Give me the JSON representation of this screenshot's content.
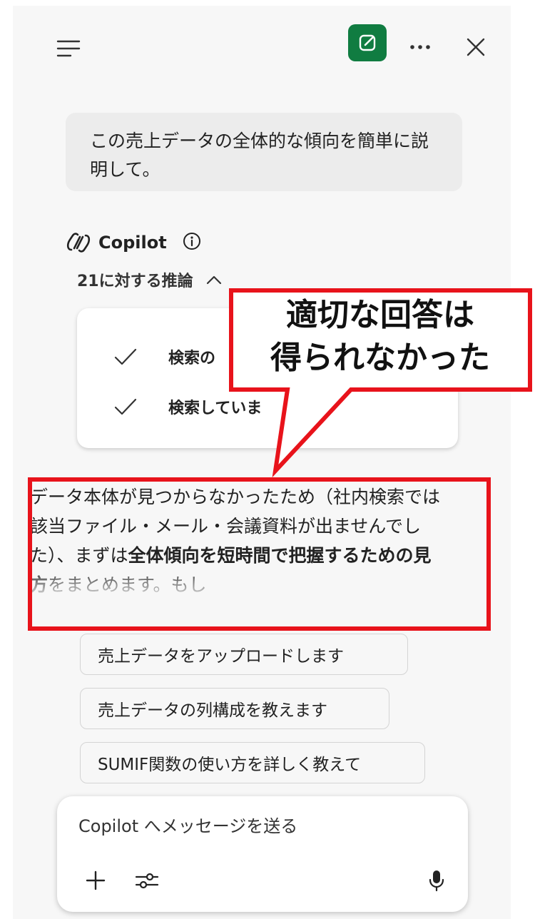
{
  "header": {
    "menu_icon": "hamburger-menu-icon",
    "new_chat_icon": "compose-icon",
    "more_icon": "more-horizontal-icon",
    "close_icon": "close-icon",
    "accent_color": "#107c41"
  },
  "chat": {
    "user_message": "この売上データの全体的な傾向を簡単に説明して。",
    "assistant_name": "Copilot",
    "assistant_logo": "copilot-logo-icon",
    "info_icon": "info-icon",
    "reasoning_label": "21に対する推論",
    "reasoning_expanded": true,
    "reasoning_steps": [
      {
        "label": "検索の",
        "status_icon": "check-icon"
      },
      {
        "label": "検索していま",
        "status_icon": "check-icon"
      }
    ],
    "response": {
      "part1": "データ本体が見つからなかったため（社内検索では該当ファイル・メール・会議資料が出ませんでした）、まずは",
      "bold": "全体傾向を短時間で把握するための見方",
      "part2": "をまとめます。もし"
    }
  },
  "suggestions": [
    "売上データをアップロードします",
    "売上データの列構成を教えます",
    "SUMIF関数の使い方を詳しく教えて"
  ],
  "composer": {
    "placeholder": "Copilot へメッセージを送る",
    "value": "",
    "add_icon": "plus-icon",
    "tools_icon": "sliders-icon",
    "mic_icon": "microphone-icon"
  },
  "annotation": {
    "line1": "適切な回答は",
    "line2": "得られなかった",
    "color": "#e8131b"
  }
}
